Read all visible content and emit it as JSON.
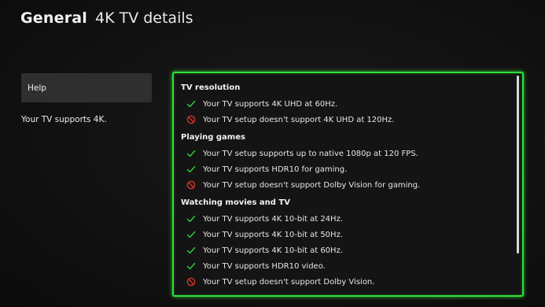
{
  "header": {
    "section": "General",
    "page_title": "4K TV details"
  },
  "sidebar": {
    "help_label": "Help",
    "summary": "Your TV supports 4K."
  },
  "colors": {
    "accent": "#32e03a",
    "pass": "#2ed03a",
    "fail": "#e0342c"
  },
  "details": {
    "groups": [
      {
        "title": "TV resolution",
        "items": [
          {
            "status": "check-icon",
            "text": "Your TV supports 4K UHD at 60Hz."
          },
          {
            "status": "blocked-icon",
            "text": "Your TV setup doesn't support 4K UHD at 120Hz."
          }
        ]
      },
      {
        "title": "Playing games",
        "items": [
          {
            "status": "check-icon",
            "text": "Your TV setup supports up to native 1080p at 120 FPS."
          },
          {
            "status": "check-icon",
            "text": "Your TV supports HDR10 for gaming."
          },
          {
            "status": "blocked-icon",
            "text": "Your TV setup doesn't support Dolby Vision for gaming."
          }
        ]
      },
      {
        "title": "Watching movies and TV",
        "items": [
          {
            "status": "check-icon",
            "text": "Your TV supports 4K 10-bit at 24Hz."
          },
          {
            "status": "check-icon",
            "text": "Your TV supports 4K 10-bit at 50Hz."
          },
          {
            "status": "check-icon",
            "text": "Your TV supports 4K 10-bit at 60Hz."
          },
          {
            "status": "check-icon",
            "text": "Your TV supports HDR10 video."
          },
          {
            "status": "blocked-icon",
            "text": "Your TV setup doesn't support Dolby Vision."
          }
        ]
      }
    ]
  }
}
